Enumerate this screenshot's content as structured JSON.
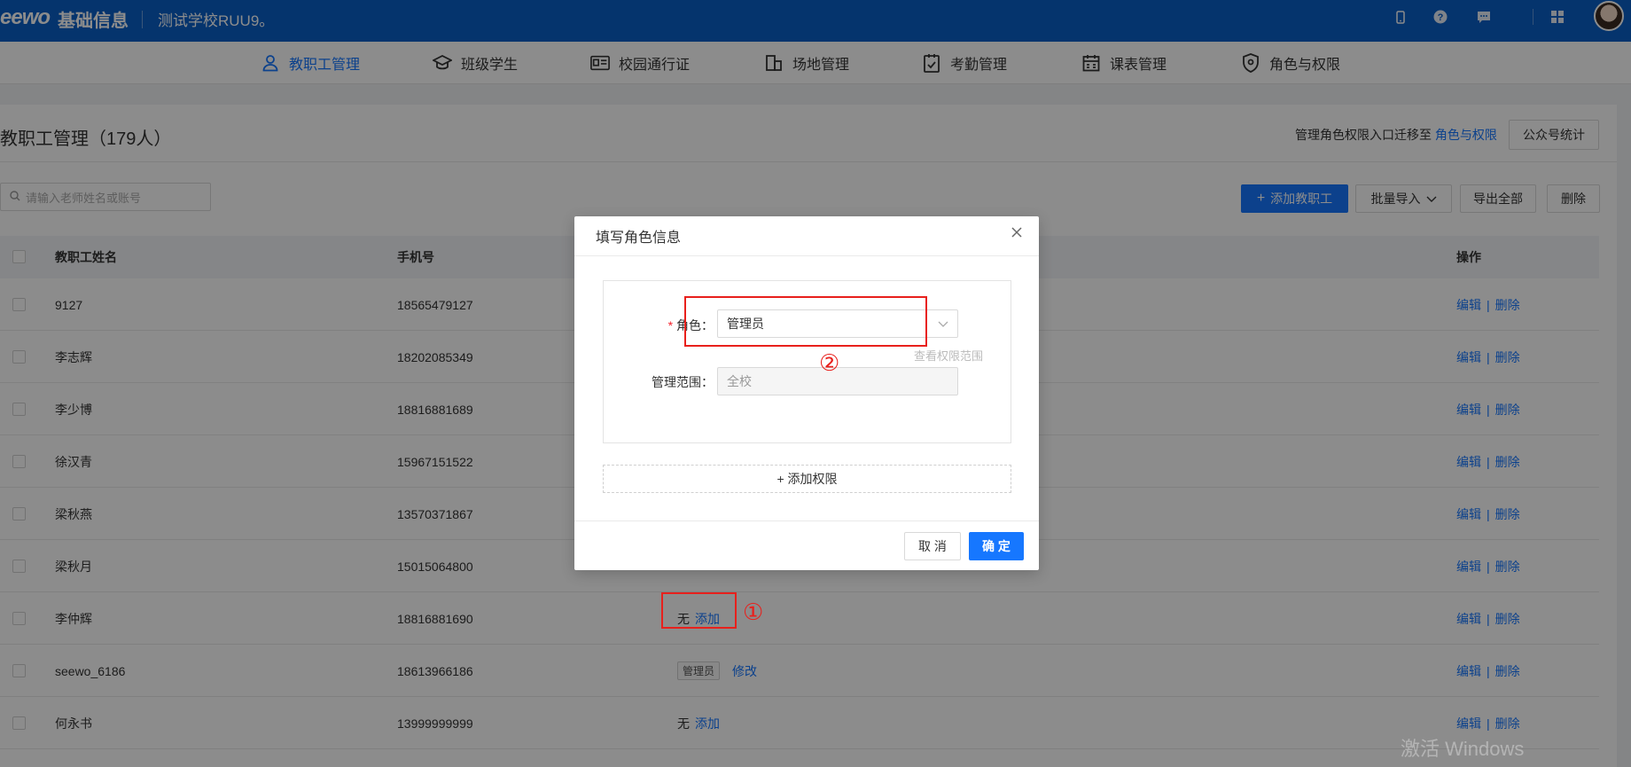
{
  "header": {
    "logo": "eewo",
    "app_title": "基础信息",
    "school": "测试学校RUU9。",
    "icons": [
      "tablet-icon",
      "help-icon",
      "message-icon",
      "apps-icon"
    ]
  },
  "nav": {
    "items": [
      {
        "label": "教职工管理",
        "icon": "person-icon",
        "active": true
      },
      {
        "label": "班级学生",
        "icon": "graduation-cap-icon"
      },
      {
        "label": "校园通行证",
        "icon": "id-card-icon"
      },
      {
        "label": "场地管理",
        "icon": "building-icon"
      },
      {
        "label": "考勤管理",
        "icon": "clipboard-check-icon"
      },
      {
        "label": "课表管理",
        "icon": "calendar-icon"
      },
      {
        "label": "角色与权限",
        "icon": "shield-icon"
      }
    ]
  },
  "page": {
    "title": "教职工管理（179人）",
    "migrate_text": "管理角色权限入口迁移至",
    "migrate_link": "角色与权限",
    "stats_button": "公众号统计",
    "search_placeholder": "请输入老师姓名或账号",
    "add_button": "添加教职工",
    "import_button": "批量导入",
    "export_button": "导出全部",
    "delete_button": "删除"
  },
  "table": {
    "headers": {
      "name": "教职工姓名",
      "phone": "手机号",
      "ops": "操作"
    },
    "edit_label": "编辑",
    "delete_label": "删除",
    "sep": "|",
    "rows": [
      {
        "name": "9127",
        "phone": "18565479127",
        "role": ""
      },
      {
        "name": "李志辉",
        "phone": "18202085349",
        "role": ""
      },
      {
        "name": "李少博",
        "phone": "18816881689",
        "role": ""
      },
      {
        "name": "徐汉青",
        "phone": "15967151522",
        "role": ""
      },
      {
        "name": "梁秋燕",
        "phone": "13570371867",
        "role": ""
      },
      {
        "name": "梁秋月",
        "phone": "15015064800",
        "role": ""
      },
      {
        "name": "李仲辉",
        "phone": "18816881690",
        "role_text": "无",
        "role_action": "添加"
      },
      {
        "name": "seewo_6186",
        "phone": "18613966186",
        "role_tag": "管理员",
        "role_action": "修改"
      },
      {
        "name": "何永书",
        "phone": "13999999999",
        "role_text": "无",
        "role_action": "添加"
      }
    ]
  },
  "modal": {
    "title": "填写角色信息",
    "role_label": "角色：",
    "role_required": "*",
    "role_value": "管理员",
    "view_scope_link": "查看权限范围",
    "scope_label": "管理范围：",
    "scope_value": "全校",
    "add_permission": "+ 添加权限",
    "cancel": "取 消",
    "confirm": "确 定"
  },
  "annotations": {
    "step1": "①",
    "step2": "②",
    "annotation_color": "#e8201c"
  },
  "watermark": "激活 Windows",
  "colors": {
    "brand": "#0a5fc7",
    "primary": "#1677ff",
    "danger": "#f5222d"
  }
}
